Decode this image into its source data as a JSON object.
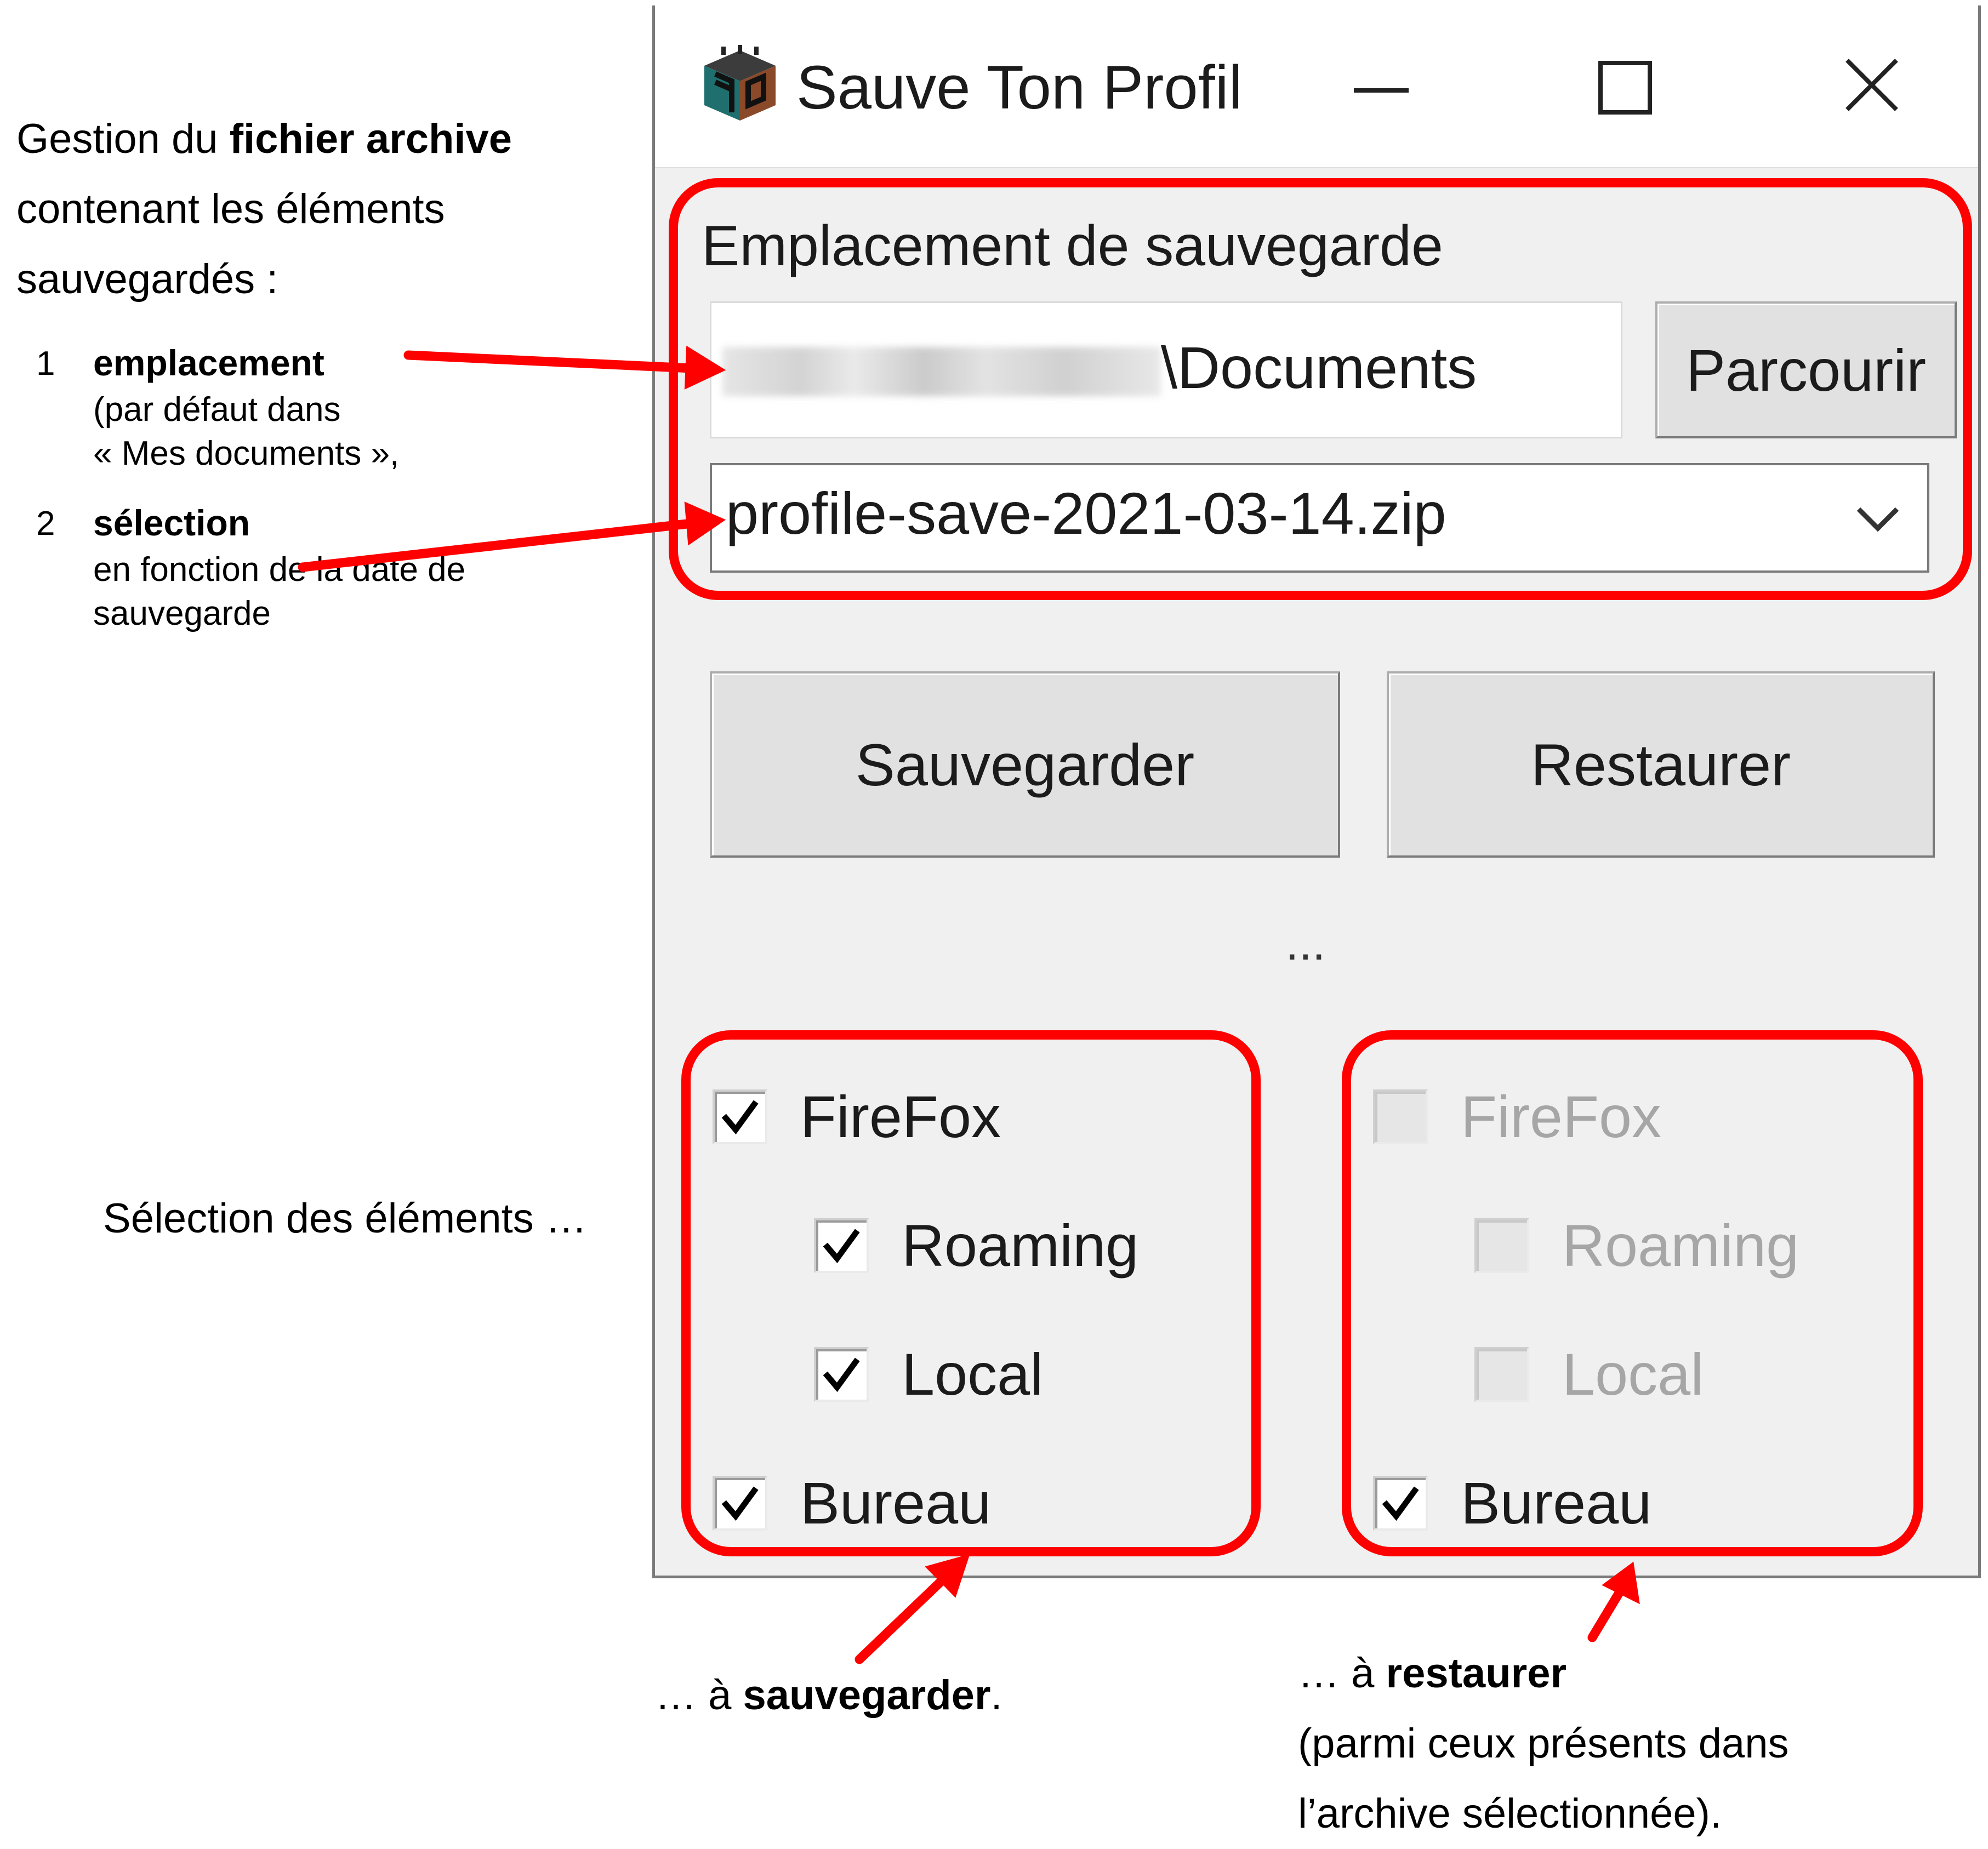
{
  "annotations": {
    "intro_prefix": "Gestion du ",
    "intro_bold": "fichier archive",
    "intro_line2": "contenant les éléments",
    "intro_line3": "sauvegardés :",
    "step1": {
      "number": "1",
      "title": "emplacement",
      "line1": "(par défaut dans",
      "line2": "« Mes documents »,"
    },
    "step2": {
      "number": "2",
      "title": "sélection",
      "line1": "en fonction de la date de",
      "line2": "sauvegarde"
    },
    "selection_caption": "Sélection des éléments …",
    "save_caption_prefix": "… à ",
    "save_caption_bold": "sauvegarder",
    "save_caption_suffix": ".",
    "restore_caption_prefix": "… à ",
    "restore_caption_bold": "restaurer",
    "restore_caption_line2": "(parmi ceux présents dans",
    "restore_caption_line3": "l’archive sélectionnée)."
  },
  "window": {
    "title": "Sauve Ton Profil",
    "icon": "app-icon",
    "controls": [
      "minimize-icon",
      "maximize-icon",
      "close-icon"
    ]
  },
  "location": {
    "group_label": "Emplacement de sauvegarde",
    "path_visible": "\\Documents",
    "browse_label": "Parcourir",
    "archive_selected": "profile-save-2021-03-14.zip"
  },
  "actions": {
    "save_label": "Sauvegarder",
    "restore_label": "Restaurer",
    "ellipsis": "..."
  },
  "save_items": [
    {
      "label": "FireFox",
      "checked": true,
      "enabled": true
    },
    {
      "label": "Roaming",
      "checked": true,
      "enabled": true
    },
    {
      "label": "Local",
      "checked": true,
      "enabled": true
    },
    {
      "label": "Bureau",
      "checked": true,
      "enabled": true
    }
  ],
  "restore_items": [
    {
      "label": "FireFox",
      "checked": false,
      "enabled": false
    },
    {
      "label": "Roaming",
      "checked": false,
      "enabled": false
    },
    {
      "label": "Local",
      "checked": false,
      "enabled": false
    },
    {
      "label": "Bureau",
      "checked": true,
      "enabled": true
    }
  ],
  "colors": {
    "highlight": "#ff0000",
    "window_bg": "#f0f0f0",
    "disabled_text": "#a6a6a6"
  }
}
